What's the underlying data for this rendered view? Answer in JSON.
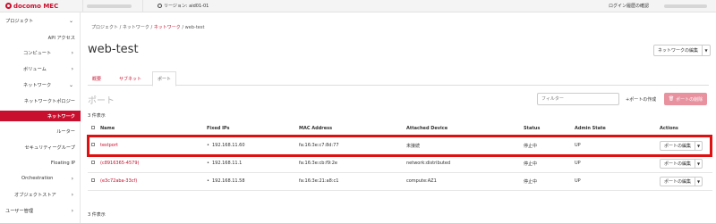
{
  "topbar": {
    "brand": "docomo MEC",
    "region": "リージョン: aid01-01",
    "login_history": "ログイン履歴の確認"
  },
  "sidebar": {
    "items": [
      {
        "label": "プロジェクト",
        "chevron": "⌄"
      },
      {
        "label": "API アクセス",
        "chevron": ""
      },
      {
        "label": "コンピュート",
        "chevron": "›"
      },
      {
        "label": "ボリューム",
        "chevron": "›"
      },
      {
        "label": "ネットワーク",
        "chevron": "⌄"
      },
      {
        "label": "ネットワークトポロジー",
        "chevron": ""
      },
      {
        "label": "ネットワーク",
        "chevron": ""
      },
      {
        "label": "ルーター",
        "chevron": ""
      },
      {
        "label": "セキュリティーグループ",
        "chevron": ""
      },
      {
        "label": "Floating IP",
        "chevron": ""
      },
      {
        "label": "Orchestration",
        "chevron": "›"
      },
      {
        "label": "オブジェクトストア",
        "chevron": "›"
      },
      {
        "label": "ユーザー管理",
        "chevron": "›"
      }
    ]
  },
  "breadcrumb": {
    "p1": "プロジェクト",
    "sep1": " / ",
    "p2": "ネットワーク",
    "sep2": " / ",
    "p3": "ネットワーク",
    "sep3": " / ",
    "p4": "web-test"
  },
  "page": {
    "title": "web-test",
    "edit_network": "ネットワークの編集"
  },
  "tabs": [
    "概要",
    "サブネット",
    "ポート"
  ],
  "ports": {
    "title": "ポート",
    "filter_placeholder": "フィルター",
    "create_label": "+ポートの作成",
    "delete_label": "ポートの削除",
    "count": "3 件表示",
    "columns": [
      "Name",
      "Fixed IPs",
      "MAC Address",
      "Attached Device",
      "Status",
      "Admin State",
      "Actions"
    ],
    "rows": [
      {
        "name": "testport",
        "ip": "192.168.11.60",
        "mac": "fa:16:3e:c7:8d:77",
        "device": "未接続",
        "status": "停止中",
        "admin": "UP",
        "action": "ポートの編集"
      },
      {
        "name": "(c8916365-4579)",
        "ip": "192.168.11.1",
        "mac": "fa:16:3e:cb:f9:2e",
        "device": "network:distributed",
        "status": "停止中",
        "admin": "UP",
        "action": "ポートの編集"
      },
      {
        "name": "(e3c72aba-33cf)",
        "ip": "192.168.11.58",
        "mac": "fa:16:3e:21:a8:c1",
        "device": "compute:AZ1",
        "status": "停止中",
        "admin": "UP",
        "action": "ポートの編集"
      }
    ]
  },
  "colors": {
    "brand": "#c8102e",
    "highlight": "#e01010",
    "delete_disabled": "#e8919f"
  }
}
